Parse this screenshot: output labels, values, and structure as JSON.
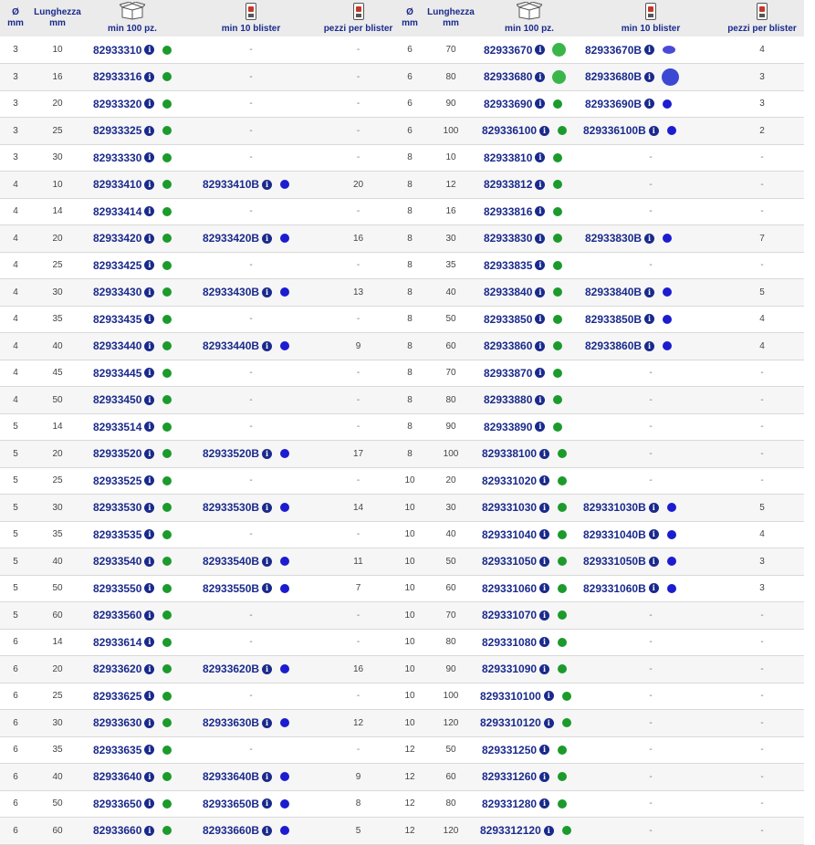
{
  "colors": {
    "header_bg": "#ebebeb",
    "code_text": "#1a2a8c",
    "avail_green": "#1c9a2c",
    "avail_blue": "#1c1cd0"
  },
  "header": {
    "diameter": "Ø",
    "diameter_unit": "mm",
    "length": "Lunghezza",
    "length_unit": "mm",
    "min_100": "min 100 pz.",
    "min_10_blister": "min 10 blister",
    "pieces_per_blister": "pezzi per blister",
    "box_icon": "box-icon",
    "blister_icon": "blister-icon"
  },
  "rows": [
    {
      "d1": "3",
      "l1": "10",
      "c1": "82933310",
      "b1": "-",
      "p1": "-",
      "d2": "6",
      "l2": "70",
      "c2": "82933670",
      "b2": "82933670B",
      "p2": "4",
      "g1": "green",
      "g2": "big-green",
      "bb1": "",
      "bb2": "oval-blue"
    },
    {
      "d1": "3",
      "l1": "16",
      "c1": "82933316",
      "b1": "-",
      "p1": "-",
      "d2": "6",
      "l2": "80",
      "c2": "82933680",
      "b2": "82933680B",
      "p2": "3",
      "g1": "green",
      "g2": "big-green",
      "bb1": "",
      "bb2": "big-blue"
    },
    {
      "d1": "3",
      "l1": "20",
      "c1": "82933320",
      "b1": "-",
      "p1": "-",
      "d2": "6",
      "l2": "90",
      "c2": "82933690",
      "b2": "82933690B",
      "p2": "3",
      "g1": "green",
      "g2": "green",
      "bb1": "",
      "bb2": "blue"
    },
    {
      "d1": "3",
      "l1": "25",
      "c1": "82933325",
      "b1": "-",
      "p1": "-",
      "d2": "6",
      "l2": "100",
      "c2": "829336100",
      "b2": "829336100B",
      "p2": "2",
      "g1": "green",
      "g2": "green",
      "bb1": "",
      "bb2": "blue"
    },
    {
      "d1": "3",
      "l1": "30",
      "c1": "82933330",
      "b1": "-",
      "p1": "-",
      "d2": "8",
      "l2": "10",
      "c2": "82933810",
      "b2": "-",
      "p2": "-",
      "g1": "green",
      "g2": "green",
      "bb1": "",
      "bb2": ""
    },
    {
      "d1": "4",
      "l1": "10",
      "c1": "82933410",
      "b1": "82933410B",
      "p1": "20",
      "d2": "8",
      "l2": "12",
      "c2": "82933812",
      "b2": "-",
      "p2": "-",
      "g1": "green",
      "g2": "green",
      "bb1": "blue",
      "bb2": ""
    },
    {
      "d1": "4",
      "l1": "14",
      "c1": "82933414",
      "b1": "-",
      "p1": "-",
      "d2": "8",
      "l2": "16",
      "c2": "82933816",
      "b2": "-",
      "p2": "-",
      "g1": "green",
      "g2": "green",
      "bb1": "",
      "bb2": ""
    },
    {
      "d1": "4",
      "l1": "20",
      "c1": "82933420",
      "b1": "82933420B",
      "p1": "16",
      "d2": "8",
      "l2": "30",
      "c2": "82933830",
      "b2": "82933830B",
      "p2": "7",
      "g1": "green",
      "g2": "green",
      "bb1": "blue",
      "bb2": "blue"
    },
    {
      "d1": "4",
      "l1": "25",
      "c1": "82933425",
      "b1": "-",
      "p1": "-",
      "d2": "8",
      "l2": "35",
      "c2": "82933835",
      "b2": "-",
      "p2": "-",
      "g1": "green",
      "g2": "green",
      "bb1": "",
      "bb2": ""
    },
    {
      "d1": "4",
      "l1": "30",
      "c1": "82933430",
      "b1": "82933430B",
      "p1": "13",
      "d2": "8",
      "l2": "40",
      "c2": "82933840",
      "b2": "82933840B",
      "p2": "5",
      "g1": "green",
      "g2": "green",
      "bb1": "blue",
      "bb2": "blue"
    },
    {
      "d1": "4",
      "l1": "35",
      "c1": "82933435",
      "b1": "-",
      "p1": "-",
      "d2": "8",
      "l2": "50",
      "c2": "82933850",
      "b2": "82933850B",
      "p2": "4",
      "g1": "green",
      "g2": "green",
      "bb1": "",
      "bb2": "blue"
    },
    {
      "d1": "4",
      "l1": "40",
      "c1": "82933440",
      "b1": "82933440B",
      "p1": "9",
      "d2": "8",
      "l2": "60",
      "c2": "82933860",
      "b2": "82933860B",
      "p2": "4",
      "g1": "green",
      "g2": "green",
      "bb1": "blue",
      "bb2": "blue"
    },
    {
      "d1": "4",
      "l1": "45",
      "c1": "82933445",
      "b1": "-",
      "p1": "-",
      "d2": "8",
      "l2": "70",
      "c2": "82933870",
      "b2": "-",
      "p2": "-",
      "g1": "green",
      "g2": "green",
      "bb1": "",
      "bb2": ""
    },
    {
      "d1": "4",
      "l1": "50",
      "c1": "82933450",
      "b1": "-",
      "p1": "-",
      "d2": "8",
      "l2": "80",
      "c2": "82933880",
      "b2": "-",
      "p2": "-",
      "g1": "green",
      "g2": "green",
      "bb1": "",
      "bb2": ""
    },
    {
      "d1": "5",
      "l1": "14",
      "c1": "82933514",
      "b1": "-",
      "p1": "-",
      "d2": "8",
      "l2": "90",
      "c2": "82933890",
      "b2": "-",
      "p2": "-",
      "g1": "green",
      "g2": "green",
      "bb1": "",
      "bb2": ""
    },
    {
      "d1": "5",
      "l1": "20",
      "c1": "82933520",
      "b1": "82933520B",
      "p1": "17",
      "d2": "8",
      "l2": "100",
      "c2": "829338100",
      "b2": "-",
      "p2": "-",
      "g1": "green",
      "g2": "green",
      "bb1": "blue",
      "bb2": ""
    },
    {
      "d1": "5",
      "l1": "25",
      "c1": "82933525",
      "b1": "-",
      "p1": "-",
      "d2": "10",
      "l2": "20",
      "c2": "829331020",
      "b2": "-",
      "p2": "-",
      "g1": "green",
      "g2": "green",
      "bb1": "",
      "bb2": ""
    },
    {
      "d1": "5",
      "l1": "30",
      "c1": "82933530",
      "b1": "82933530B",
      "p1": "14",
      "d2": "10",
      "l2": "30",
      "c2": "829331030",
      "b2": "829331030B",
      "p2": "5",
      "g1": "green",
      "g2": "green",
      "bb1": "blue",
      "bb2": "blue"
    },
    {
      "d1": "5",
      "l1": "35",
      "c1": "82933535",
      "b1": "-",
      "p1": "-",
      "d2": "10",
      "l2": "40",
      "c2": "829331040",
      "b2": "829331040B",
      "p2": "4",
      "g1": "green",
      "g2": "green",
      "bb1": "",
      "bb2": "blue"
    },
    {
      "d1": "5",
      "l1": "40",
      "c1": "82933540",
      "b1": "82933540B",
      "p1": "11",
      "d2": "10",
      "l2": "50",
      "c2": "829331050",
      "b2": "829331050B",
      "p2": "3",
      "g1": "green",
      "g2": "green",
      "bb1": "blue",
      "bb2": "blue"
    },
    {
      "d1": "5",
      "l1": "50",
      "c1": "82933550",
      "b1": "82933550B",
      "p1": "7",
      "d2": "10",
      "l2": "60",
      "c2": "829331060",
      "b2": "829331060B",
      "p2": "3",
      "g1": "green",
      "g2": "green",
      "bb1": "blue",
      "bb2": "blue"
    },
    {
      "d1": "5",
      "l1": "60",
      "c1": "82933560",
      "b1": "-",
      "p1": "-",
      "d2": "10",
      "l2": "70",
      "c2": "829331070",
      "b2": "-",
      "p2": "-",
      "g1": "green",
      "g2": "green",
      "bb1": "",
      "bb2": ""
    },
    {
      "d1": "6",
      "l1": "14",
      "c1": "82933614",
      "b1": "-",
      "p1": "-",
      "d2": "10",
      "l2": "80",
      "c2": "829331080",
      "b2": "-",
      "p2": "-",
      "g1": "green",
      "g2": "green",
      "bb1": "",
      "bb2": ""
    },
    {
      "d1": "6",
      "l1": "20",
      "c1": "82933620",
      "b1": "82933620B",
      "p1": "16",
      "d2": "10",
      "l2": "90",
      "c2": "829331090",
      "b2": "-",
      "p2": "-",
      "g1": "green",
      "g2": "green",
      "bb1": "blue",
      "bb2": ""
    },
    {
      "d1": "6",
      "l1": "25",
      "c1": "82933625",
      "b1": "-",
      "p1": "-",
      "d2": "10",
      "l2": "100",
      "c2": "8293310100",
      "b2": "-",
      "p2": "-",
      "g1": "green",
      "g2": "green",
      "bb1": "",
      "bb2": ""
    },
    {
      "d1": "6",
      "l1": "30",
      "c1": "82933630",
      "b1": "82933630B",
      "p1": "12",
      "d2": "10",
      "l2": "120",
      "c2": "8293310120",
      "b2": "-",
      "p2": "-",
      "g1": "green",
      "g2": "green",
      "bb1": "blue",
      "bb2": ""
    },
    {
      "d1": "6",
      "l1": "35",
      "c1": "82933635",
      "b1": "-",
      "p1": "-",
      "d2": "12",
      "l2": "50",
      "c2": "829331250",
      "b2": "-",
      "p2": "-",
      "g1": "green",
      "g2": "green",
      "bb1": "",
      "bb2": ""
    },
    {
      "d1": "6",
      "l1": "40",
      "c1": "82933640",
      "b1": "82933640B",
      "p1": "9",
      "d2": "12",
      "l2": "60",
      "c2": "829331260",
      "b2": "-",
      "p2": "-",
      "g1": "green",
      "g2": "green",
      "bb1": "blue",
      "bb2": ""
    },
    {
      "d1": "6",
      "l1": "50",
      "c1": "82933650",
      "b1": "82933650B",
      "p1": "8",
      "d2": "12",
      "l2": "80",
      "c2": "829331280",
      "b2": "-",
      "p2": "-",
      "g1": "green",
      "g2": "green",
      "bb1": "blue",
      "bb2": ""
    },
    {
      "d1": "6",
      "l1": "60",
      "c1": "82933660",
      "b1": "82933660B",
      "p1": "5",
      "d2": "12",
      "l2": "120",
      "c2": "8293312120",
      "b2": "-",
      "p2": "-",
      "g1": "green",
      "g2": "green",
      "bb1": "blue",
      "bb2": ""
    }
  ]
}
